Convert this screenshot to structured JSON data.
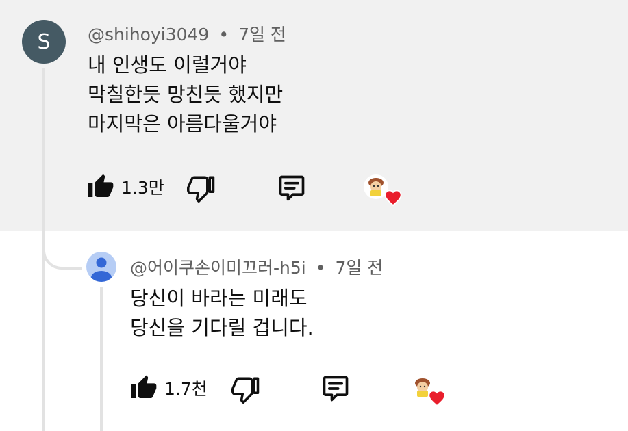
{
  "comment": {
    "avatar_letter": "S",
    "author": "@shihoyi3049",
    "separator": "•",
    "time": "7일 전",
    "lines": [
      "내 인생도 이럴거야",
      "막칠한듯 망친듯 했지만",
      "마지막은 아름다울거야"
    ],
    "like_count": "1.3만"
  },
  "reply": {
    "author": "@어이쿠손이미끄러-h5i",
    "separator": "•",
    "time": "7일 전",
    "lines": [
      "당신이 바라는 미래도",
      "당신을 기다릴 겁니다."
    ],
    "like_count": "1.7천"
  },
  "icons": {
    "like": "thumbs-up-filled-icon",
    "dislike": "thumbs-down-outline-icon",
    "reply": "reply-comment-icon",
    "creator_heart": "creator-heart-badge"
  },
  "colors": {
    "highlight_bg": "#f1f1f1",
    "avatar_s": "#455a64",
    "avatar_default": "#b6cdf5",
    "heart": "#e91e2c",
    "meta_text": "#606060"
  }
}
